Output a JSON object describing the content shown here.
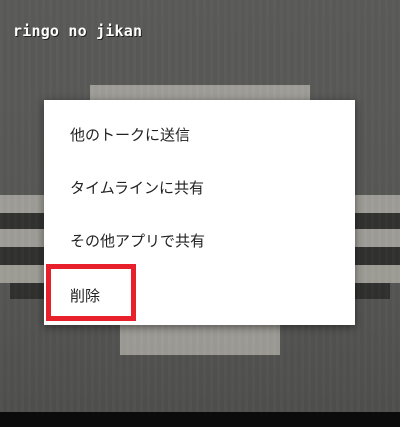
{
  "watermark": {
    "text": "ringo no jikan"
  },
  "context_menu": {
    "items": [
      {
        "label": "他のトークに送信"
      },
      {
        "label": "タイムラインに共有"
      },
      {
        "label": "その他アプリで共有"
      },
      {
        "label": "削除"
      }
    ],
    "highlighted_item": "削除",
    "highlight_color": "#e8202c"
  }
}
